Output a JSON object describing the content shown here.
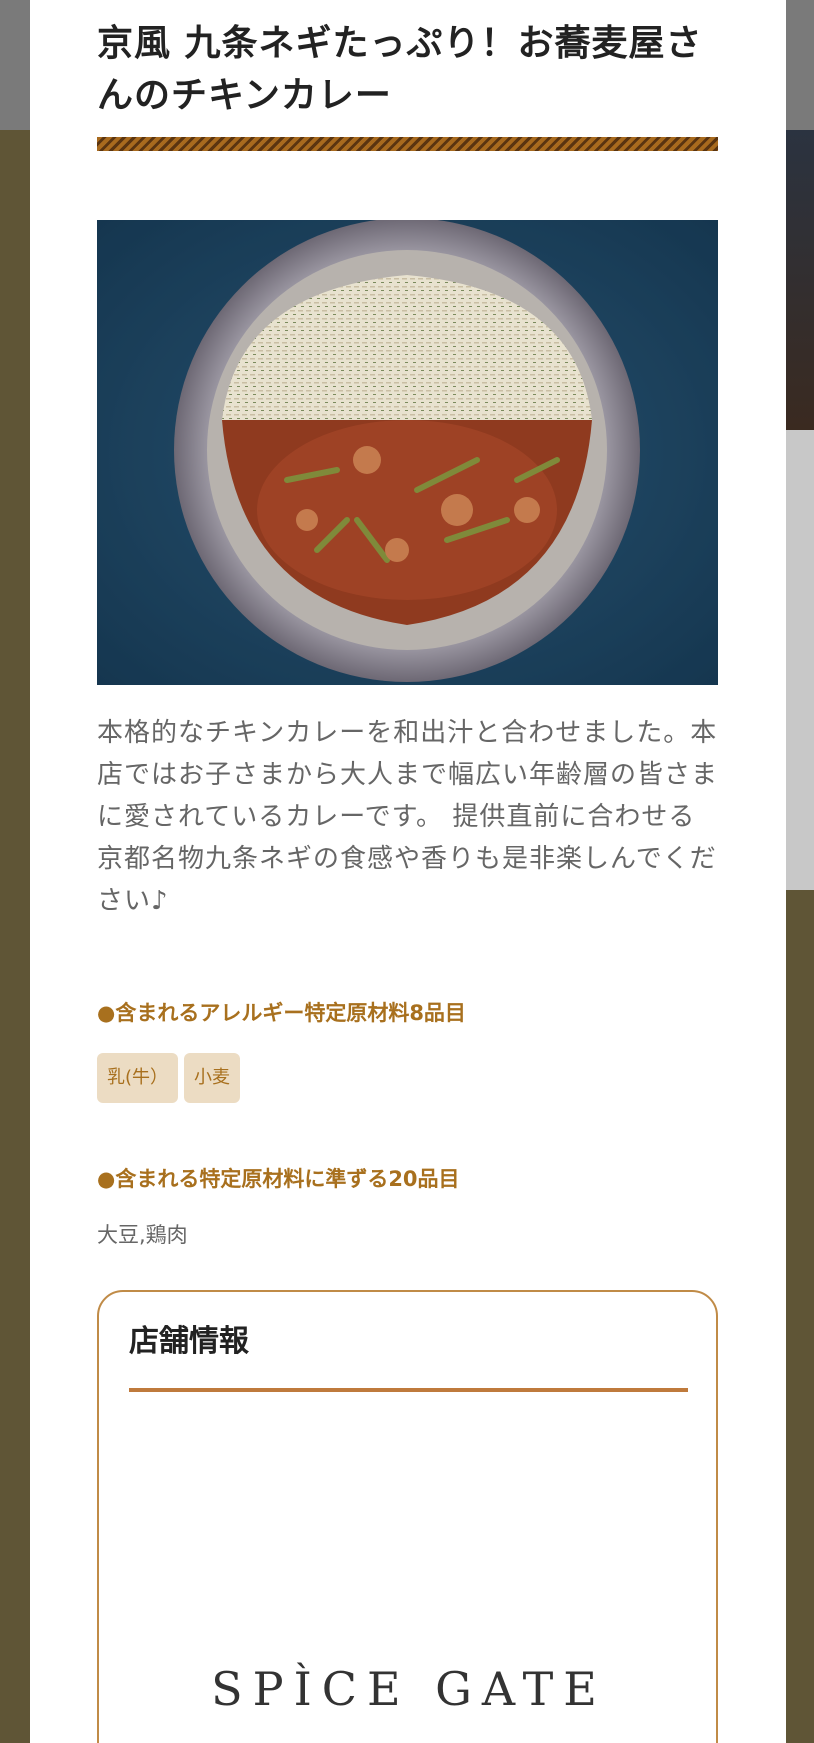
{
  "product": {
    "title": "京風 九条ネギたっぷり！お蕎麦屋さんのチキンカレー",
    "description": "本格的なチキンカレーを和出汁と合わせました。本店ではお子さまから大人まで幅広い年齢層の皆さまに愛されているカレーです。 提供直前に合わせる京都名物九条ネギの食感や香りも是非楽しんでください♪",
    "image_icon": "curry-photo"
  },
  "allergens": {
    "specified_heading": "●含まれるアレルギー特定原材料8品目",
    "specified_tags": [
      "乳(牛）",
      "小麦"
    ],
    "equivalent_heading": "●含まれる特定原材料に準ずる20品目",
    "equivalent_items": "大豆,鶏肉"
  },
  "store": {
    "heading": "店舗情報",
    "logo_text": "SPÌCE GATE"
  },
  "colors": {
    "accent": "#a8701e",
    "tag_bg": "#ecdcc3",
    "border": "#c08b47",
    "background": "#5f5536"
  }
}
